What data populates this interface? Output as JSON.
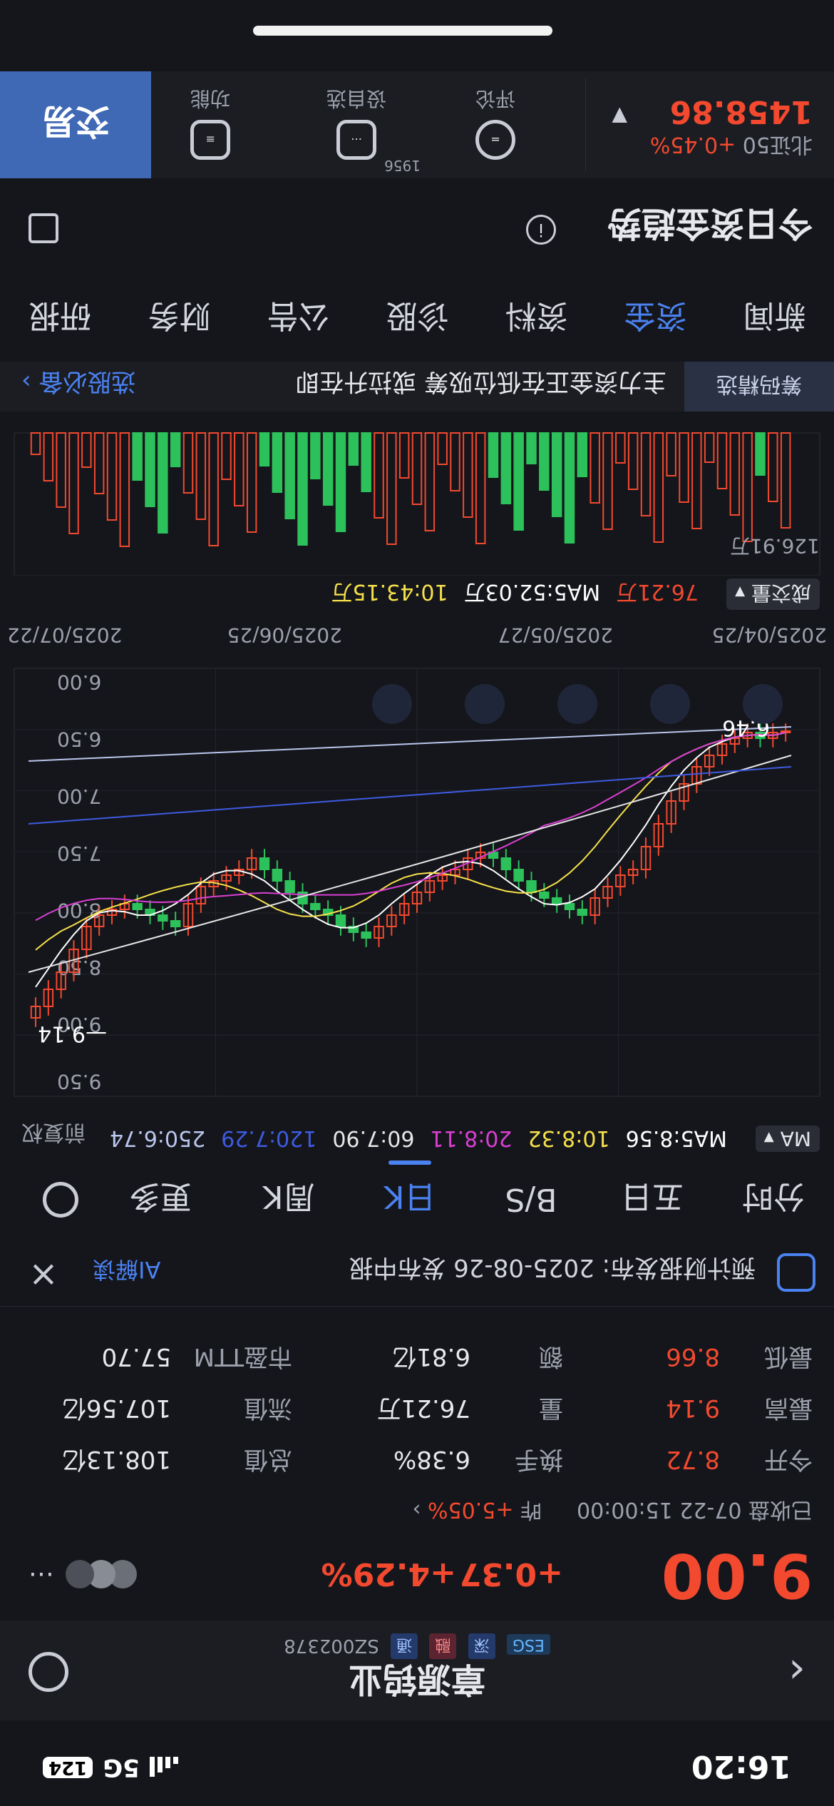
{
  "status_bar": {
    "time": "16:20",
    "network": "5G",
    "battery": "124"
  },
  "stock": {
    "name": "章源钨业",
    "code": "SZ002378",
    "badges": [
      "ESG",
      "深",
      "融",
      "通"
    ],
    "price": "9.00",
    "change": "+0.37",
    "change_pct": "+4.29%",
    "status_text": "已收盘 07-22 15:00:00",
    "turnover_label": "昨",
    "turnover_value": "+5.05%",
    "stats": [
      {
        "label": "今开",
        "value": "8.72",
        "label2": "换手",
        "value2": "6.38%",
        "label3": "总值",
        "value3": "108.13亿"
      },
      {
        "label": "最高",
        "value": "9.14",
        "label2": "量",
        "value2": "76.21万",
        "label3": "流值",
        "value3": "107.56亿"
      },
      {
        "label": "最低",
        "value": "8.66",
        "label2": "额",
        "value2": "6.81亿",
        "label3": "市盈TTM",
        "value3": "57.70"
      }
    ],
    "report_text": "预计财报发布: 2025-08-26 发布中报",
    "ai_label": "AI解读"
  },
  "chart_tabs": [
    "分时",
    "五日",
    "日K",
    "周K",
    "更多"
  ],
  "chart_tabs_extra": "B/S",
  "active_chart_tab": "日K",
  "ma_bar": {
    "dropdown": "MA",
    "ma5": "MA5:8.56",
    "ma10": "10:8.32",
    "ma20": "20:8.11",
    "ma60": "60:7.90",
    "ma120": "120:7.29",
    "ma250": "250:6.74",
    "adj": "前复权"
  },
  "price_axis": [
    "9.50",
    "9.00",
    "8.50",
    "8.00",
    "7.50",
    "7.00",
    "6.50",
    "6.00"
  ],
  "date_axis": [
    "2025/04/25",
    "2025/05/27",
    "2025/06/25",
    "2025/07/22"
  ],
  "chart_annotations": {
    "high": "9.14",
    "low": "6.46"
  },
  "colors": {
    "up": "#f3492f",
    "down": "#2cc15a",
    "ma5": "#ffffff",
    "ma10": "#f6e14b",
    "ma20": "#d93fd2",
    "ma60": "#e6e6e6",
    "ma120": "#3d5be0",
    "ma250": "#b9c6ee",
    "accent": "#4b82f1"
  },
  "volume_bar": {
    "dropdown": "成交量",
    "vol": "76.21万",
    "ma5": "MA5:52.03万",
    "ma10": "10:43.15万",
    "axis_max": "126.91万"
  },
  "banner": {
    "tag": "筹码精选",
    "text": "主力资金正在低位吸筹 或拉升在即",
    "link": "选股必备"
  },
  "nav_tabs": [
    "新闻",
    "资金",
    "资料",
    "诊股",
    "公告",
    "财务",
    "研报"
  ],
  "active_nav": "资金",
  "flow_section": {
    "title": "今日资金趋势"
  },
  "bottom_bar": {
    "index_name": "北证50",
    "index_change": "+0.45%",
    "index_value": "1458.86",
    "actions": [
      {
        "label": "评论",
        "icon": "comment-icon"
      },
      {
        "label": "设自选",
        "icon": "watchlist-icon",
        "count": "1956"
      },
      {
        "label": "功能",
        "icon": "menu-icon"
      }
    ],
    "trade": "交易"
  }
}
